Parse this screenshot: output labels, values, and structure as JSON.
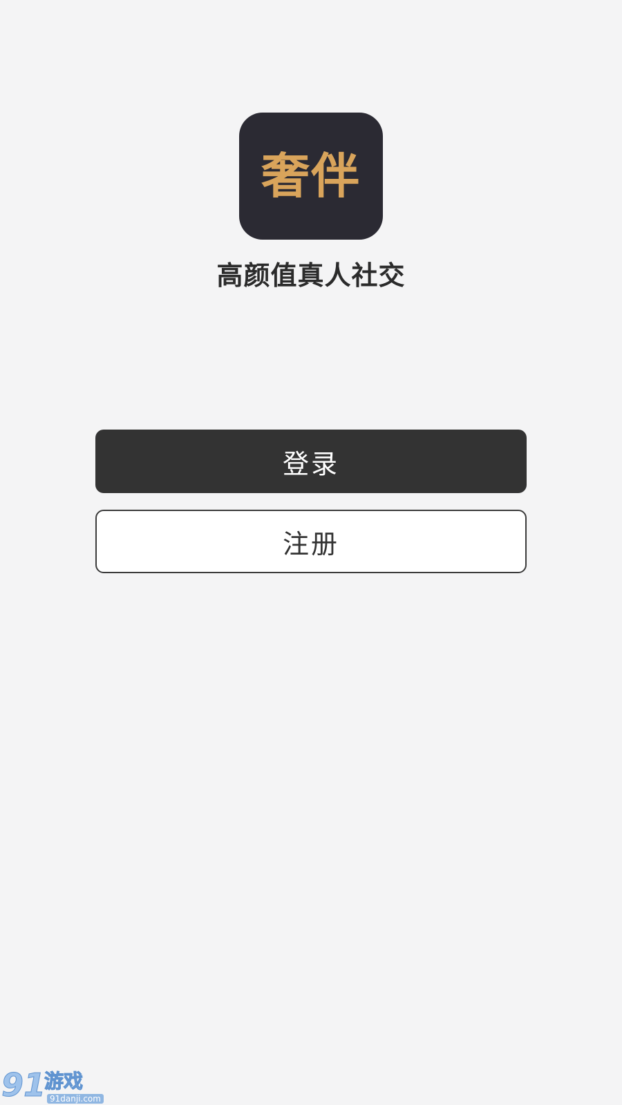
{
  "app": {
    "icon_text": "奢伴",
    "slogan": "高颜值真人社交"
  },
  "buttons": {
    "login_label": "登录",
    "register_label": "注册"
  },
  "watermark": {
    "number": "91",
    "name": "游戏",
    "url": "91danji.com"
  },
  "colors": {
    "background": "#f4f4f5",
    "icon_bg": "#2b2a33",
    "icon_text": "#d9a45b",
    "login_bg": "#333333",
    "register_border": "#3b3b3b"
  }
}
